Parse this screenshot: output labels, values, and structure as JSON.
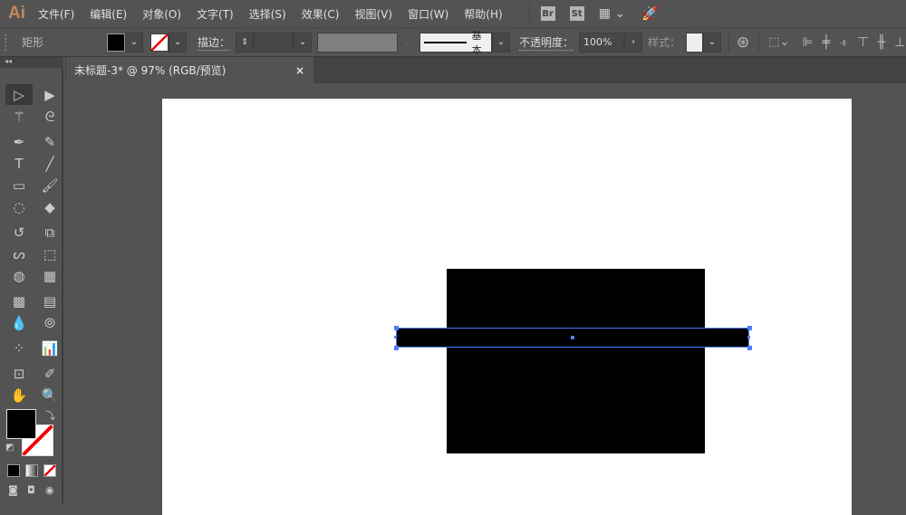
{
  "app": {
    "logo": "Ai"
  },
  "menu": [
    "文件(F)",
    "编辑(E)",
    "对象(O)",
    "文字(T)",
    "选择(S)",
    "效果(C)",
    "视图(V)",
    "窗口(W)",
    "帮助(H)"
  ],
  "menu_icons": {
    "bridge": "Br",
    "stock": "St"
  },
  "control": {
    "object_type": "矩形",
    "stroke_label": "描边：",
    "stroke_profile": "基本",
    "opacity_label": "不透明度：",
    "opacity_value": "100%",
    "style_label": "样式："
  },
  "document_tab": {
    "title": "未标题-3* @ 97% (RGB/预览)",
    "close": "×"
  },
  "colors": {
    "fill": "#000000",
    "stroke": "none",
    "selection": "#4d7cff",
    "accent": "#c8875a"
  },
  "tools": [
    "selection-tool",
    "direct-selection-tool",
    "magic-wand-tool",
    "lasso-tool",
    "pen-tool",
    "curvature-tool",
    "type-tool",
    "line-tool",
    "rectangle-tool",
    "paintbrush-tool",
    "shaper-tool",
    "eraser-tool",
    "rotate-tool",
    "scale-tool",
    "warp-tool",
    "free-transform-tool",
    "shape-builder-tool",
    "perspective-grid-tool",
    "mesh-tool",
    "gradient-tool",
    "eyedropper-tool",
    "blend-tool",
    "symbol-sprayer-tool",
    "column-graph-tool",
    "artboard-tool",
    "slice-tool",
    "hand-tool",
    "zoom-tool"
  ],
  "tool_glyphs": [
    "▷",
    "▶",
    "⚚",
    "ᘓ",
    "✒",
    "✎",
    "T",
    "╱",
    "▭",
    "🖌",
    "◌",
    "◆",
    "↺",
    "⧉",
    "ᔕ",
    "⬚",
    "◍",
    "▦",
    "▩",
    "▤",
    "💧",
    "⦾",
    "⁘",
    "📊",
    "⊡",
    "✐",
    "✋",
    "🔍"
  ]
}
